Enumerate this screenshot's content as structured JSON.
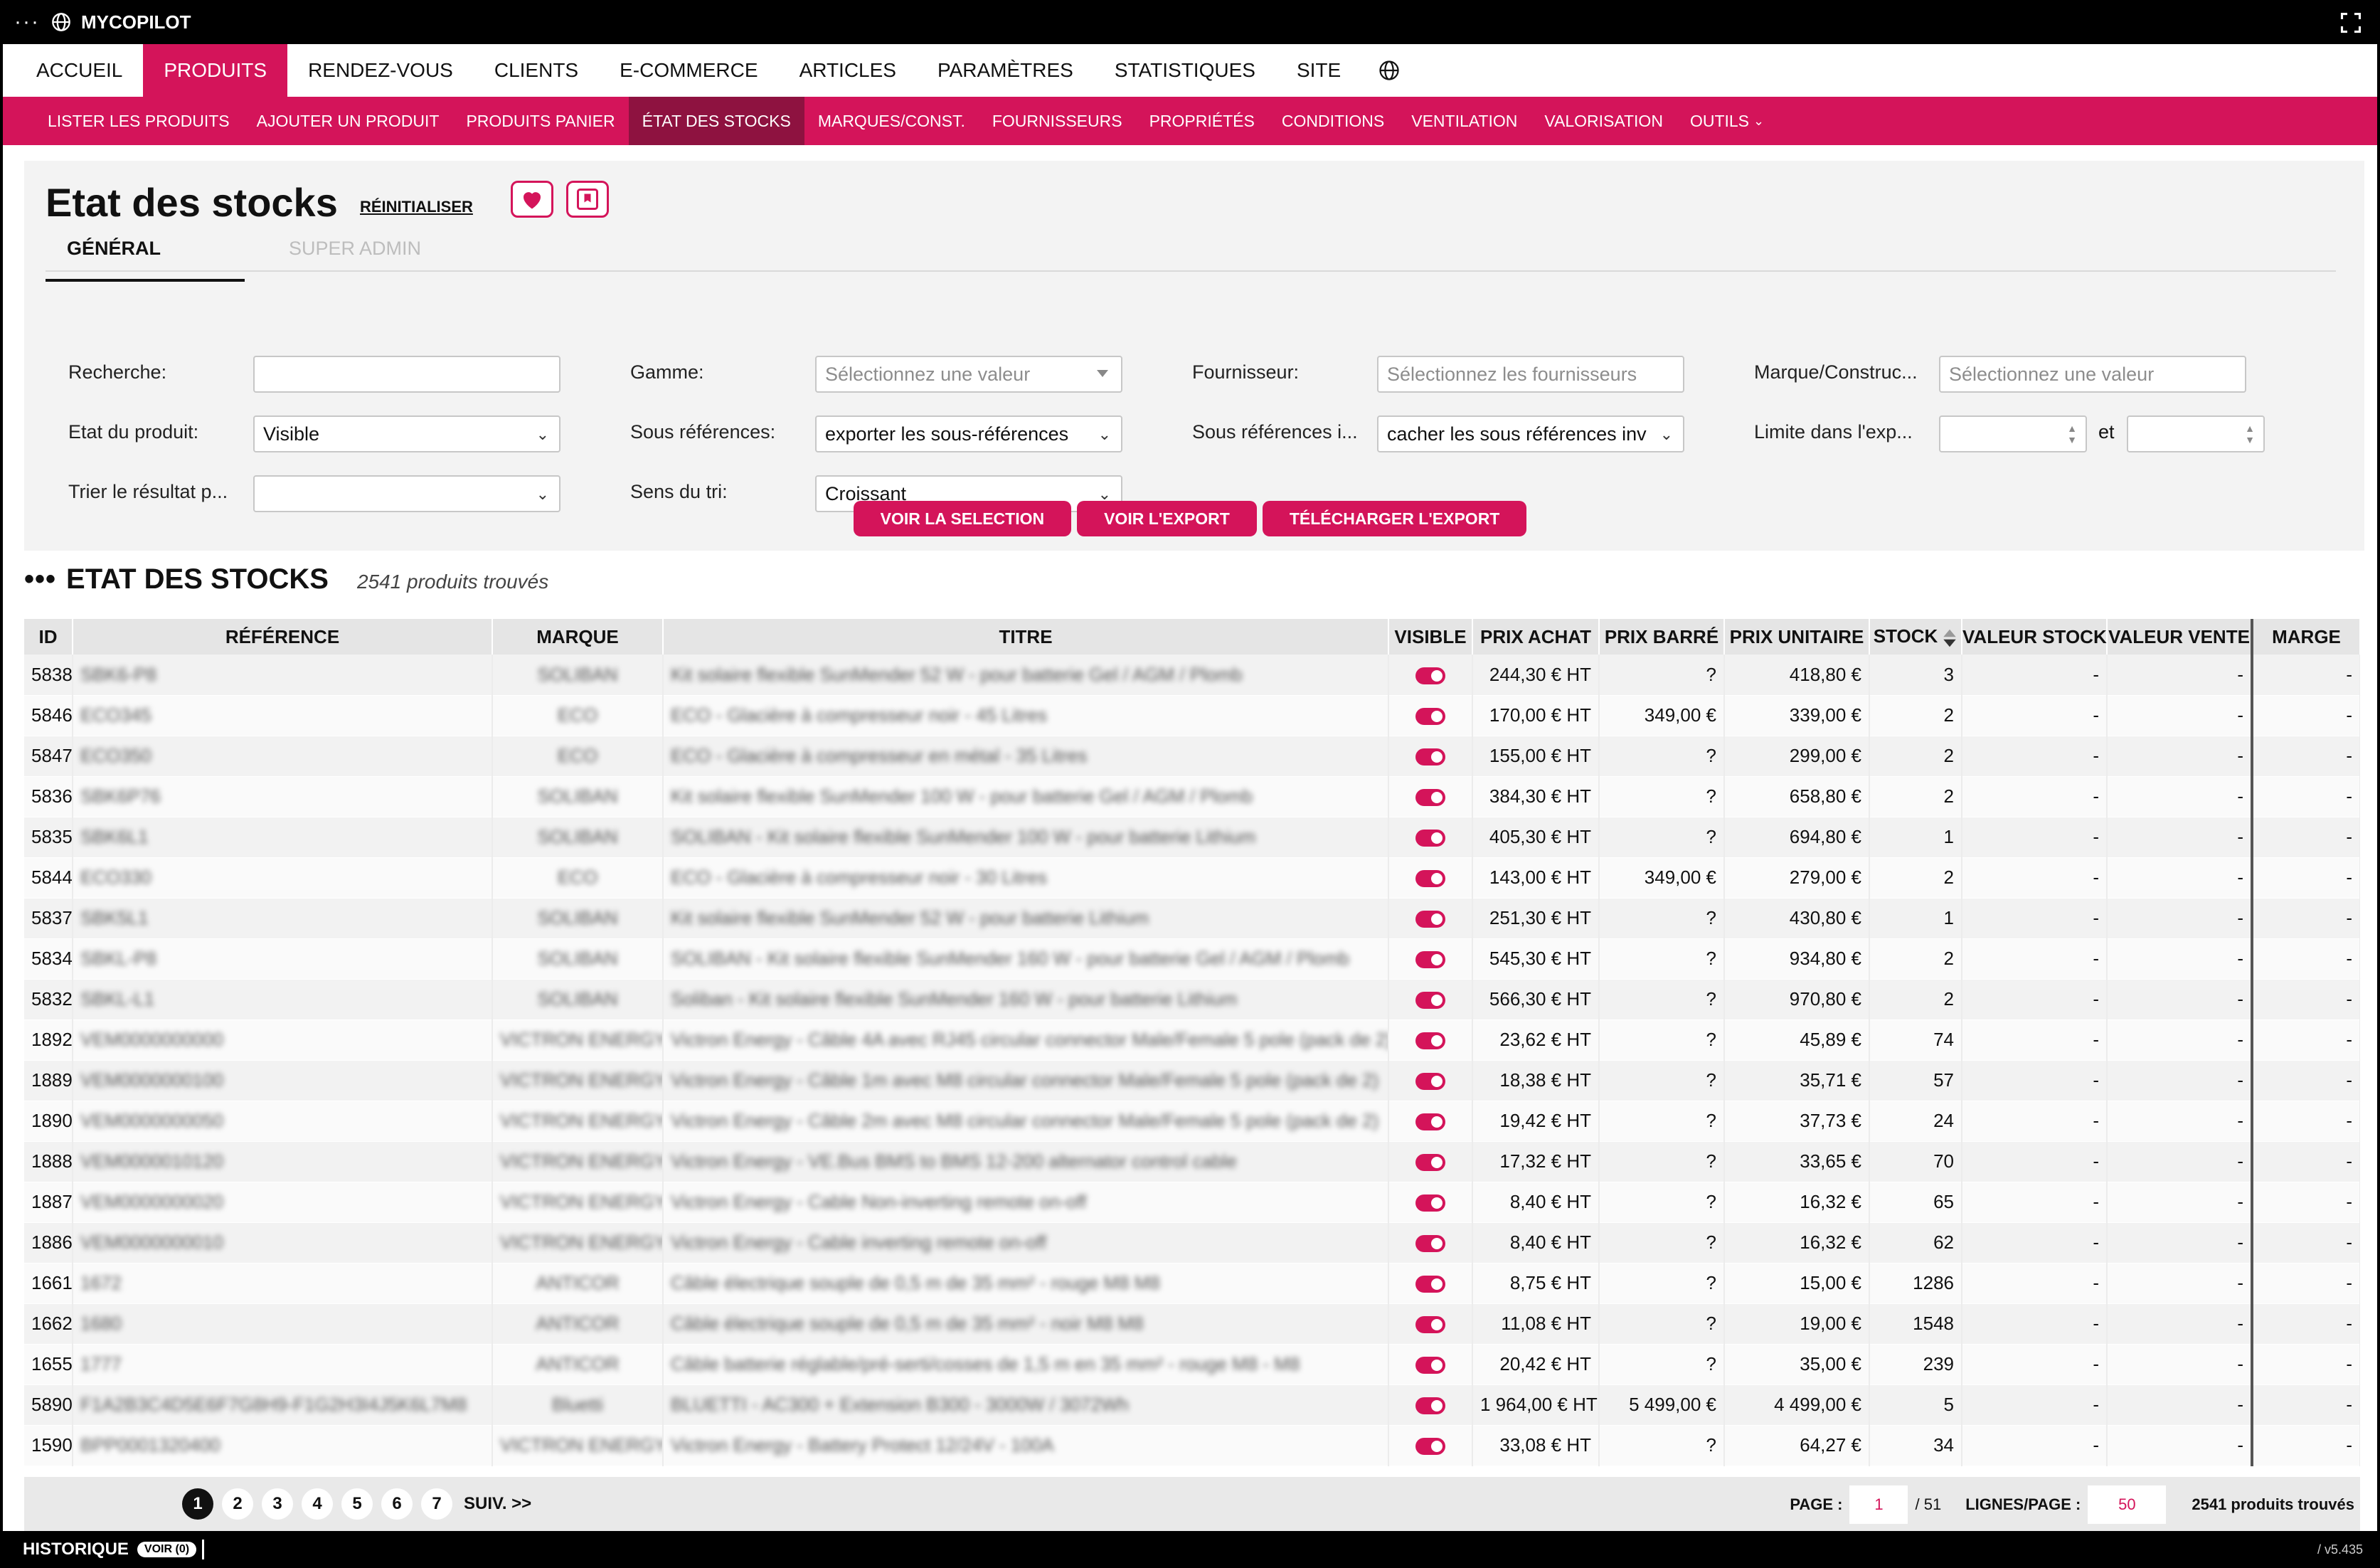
{
  "app": {
    "title": "MYCOPILOT",
    "version": "/ v5.435"
  },
  "mainnav": [
    {
      "label": "ACCUEIL",
      "active": false
    },
    {
      "label": "PRODUITS",
      "active": true
    },
    {
      "label": "RENDEZ-VOUS",
      "active": false
    },
    {
      "label": "CLIENTS",
      "active": false
    },
    {
      "label": "E-COMMERCE",
      "active": false
    },
    {
      "label": "ARTICLES",
      "active": false
    },
    {
      "label": "PARAMÈTRES",
      "active": false
    },
    {
      "label": "STATISTIQUES",
      "active": false
    },
    {
      "label": "SITE",
      "active": false
    }
  ],
  "subnav": [
    {
      "label": "LISTER LES PRODUITS",
      "active": false
    },
    {
      "label": "AJOUTER UN PRODUIT",
      "active": false
    },
    {
      "label": "PRODUITS PANIER",
      "active": false
    },
    {
      "label": "ÉTAT DES STOCKS",
      "active": true
    },
    {
      "label": "MARQUES/CONST.",
      "active": false
    },
    {
      "label": "FOURNISSEURS",
      "active": false
    },
    {
      "label": "PROPRIÉTÉS",
      "active": false
    },
    {
      "label": "CONDITIONS",
      "active": false
    },
    {
      "label": "VENTILATION",
      "active": false
    },
    {
      "label": "VALORISATION",
      "active": false
    },
    {
      "label": "OUTILS",
      "active": false
    }
  ],
  "page": {
    "title": "Etat des stocks",
    "reset_label": "RÉINITIALISER",
    "tabs": [
      "GÉNÉRAL",
      "SUPER ADMIN"
    ]
  },
  "filters": {
    "recherche": {
      "label": "Recherche:",
      "value": ""
    },
    "gamme": {
      "label": "Gamme:",
      "placeholder": "Sélectionnez une valeur"
    },
    "fournisseur": {
      "label": "Fournisseur:",
      "placeholder": "Sélectionnez les fournisseurs"
    },
    "marque": {
      "label": "Marque/Construc...",
      "placeholder": "Sélectionnez une valeur"
    },
    "etat": {
      "label": "Etat du produit:",
      "value": "Visible"
    },
    "sousref": {
      "label": "Sous références:",
      "value": "exporter les sous-références"
    },
    "sousref_inv": {
      "label": "Sous références i...",
      "value": "cacher les sous références inv"
    },
    "limite": {
      "label": "Limite dans l'exp...",
      "and": "et"
    },
    "trier": {
      "label": "Trier le résultat p...",
      "value": ""
    },
    "sens": {
      "label": "Sens du tri:",
      "value": "Croissant"
    }
  },
  "actions": [
    "VOIR LA SELECTION",
    "VOIR L'EXPORT",
    "TÉLÉCHARGER L'EXPORT"
  ],
  "results": {
    "title": "ETAT DES STOCKS",
    "count": "2541 produits trouvés"
  },
  "table": {
    "columns": [
      "ID",
      "RÉFÉRENCE",
      "MARQUE",
      "TITRE",
      "VISIBLE",
      "PRIX ACHAT",
      "PRIX BARRÉ",
      "PRIX UNITAIRE",
      "STOCK",
      "VALEUR STOCK",
      "VALEUR VENTE",
      "MARGE"
    ],
    "rows": [
      {
        "id": "5838",
        "ref": "SBK6-P8",
        "marque": "SOLIBAN",
        "titre": "Kit solaire flexible SunMender 52 W - pour batterie Gel / AGM / Plomb",
        "achat": "244,30 € HT",
        "barre": "?",
        "unit": "418,80 €",
        "stock": "3"
      },
      {
        "id": "5846",
        "ref": "ECO345",
        "marque": "ECO",
        "titre": "ECO - Glacière à compresseur noir - 45 Litres",
        "achat": "170,00 € HT",
        "barre": "349,00 €",
        "unit": "339,00 €",
        "stock": "2"
      },
      {
        "id": "5847",
        "ref": "ECO350",
        "marque": "ECO",
        "titre": "ECO - Glacière à compresseur en métal - 35 Litres",
        "achat": "155,00 € HT",
        "barre": "?",
        "unit": "299,00 €",
        "stock": "2"
      },
      {
        "id": "5836",
        "ref": "SBK6P76",
        "marque": "SOLIBAN",
        "titre": "Kit solaire flexible SunMender 100 W - pour batterie Gel / AGM / Plomb",
        "achat": "384,30 € HT",
        "barre": "?",
        "unit": "658,80 €",
        "stock": "2"
      },
      {
        "id": "5835",
        "ref": "SBK6L1",
        "marque": "SOLIBAN",
        "titre": "SOLIBAN - Kit solaire flexible SunMender 100 W - pour batterie Lithium",
        "achat": "405,30 € HT",
        "barre": "?",
        "unit": "694,80 €",
        "stock": "1"
      },
      {
        "id": "5844",
        "ref": "ECO330",
        "marque": "ECO",
        "titre": "ECO - Glacière à compresseur noir - 30 Litres",
        "achat": "143,00 € HT",
        "barre": "349,00 €",
        "unit": "279,00 €",
        "stock": "2"
      },
      {
        "id": "5837",
        "ref": "SBK5L1",
        "marque": "SOLIBAN",
        "titre": "Kit solaire flexible SunMender 52 W - pour batterie Lithium",
        "achat": "251,30 € HT",
        "barre": "?",
        "unit": "430,80 €",
        "stock": "1"
      },
      {
        "id": "5834",
        "ref": "SBKL-P8",
        "marque": "SOLIBAN",
        "titre": "SOLIBAN - Kit solaire flexible SunMender 160 W - pour batterie Gel / AGM / Plomb",
        "achat": "545,30 € HT",
        "barre": "?",
        "unit": "934,80 €",
        "stock": "2"
      },
      {
        "id": "5832",
        "ref": "SBKL-L1",
        "marque": "SOLIBAN",
        "titre": "Soliban - Kit solaire flexible SunMender 160 W - pour batterie Lithium",
        "achat": "566,30 € HT",
        "barre": "?",
        "unit": "970,80 €",
        "stock": "2"
      },
      {
        "id": "1892",
        "ref": "VEM0000000000",
        "marque": "VICTRON ENERGY",
        "titre": "Victron Energy - Câble 4A avec RJ45 circular connector Male/Female 5 pole (pack de 2)",
        "achat": "23,62 € HT",
        "barre": "?",
        "unit": "45,89 €",
        "stock": "74"
      },
      {
        "id": "1889",
        "ref": "VEM0000000100",
        "marque": "VICTRON ENERGY",
        "titre": "Victron Energy - Câble 1m avec M8 circular connector Male/Female 5 pole (pack de 2)",
        "achat": "18,38 € HT",
        "barre": "?",
        "unit": "35,71 €",
        "stock": "57"
      },
      {
        "id": "1890",
        "ref": "VEM0000000050",
        "marque": "VICTRON ENERGY",
        "titre": "Victron Energy - Câble 2m avec M8 circular connector Male/Female 5 pole (pack de 2)",
        "achat": "19,42 € HT",
        "barre": "?",
        "unit": "37,73 €",
        "stock": "24"
      },
      {
        "id": "1888",
        "ref": "VEM0000010120",
        "marque": "VICTRON ENERGY",
        "titre": "Victron Energy - VE.Bus BMS to BMS 12-200 alternator control cable",
        "achat": "17,32 € HT",
        "barre": "?",
        "unit": "33,65 €",
        "stock": "70"
      },
      {
        "id": "1887",
        "ref": "VEM0000000020",
        "marque": "VICTRON ENERGY",
        "titre": "Victron Energy - Cable Non-inverting remote on-off",
        "achat": "8,40 € HT",
        "barre": "?",
        "unit": "16,32 €",
        "stock": "65"
      },
      {
        "id": "1886",
        "ref": "VEM0000000010",
        "marque": "VICTRON ENERGY",
        "titre": "Victron Energy - Cable inverting remote on-off",
        "achat": "8,40 € HT",
        "barre": "?",
        "unit": "16,32 €",
        "stock": "62"
      },
      {
        "id": "1661",
        "ref": "1672",
        "marque": "ANTICOR",
        "titre": "Câble électrique souple de 0,5 m de 35 mm² - rouge M8 M8",
        "achat": "8,75 € HT",
        "barre": "?",
        "unit": "15,00 €",
        "stock": "1286"
      },
      {
        "id": "1662",
        "ref": "1680",
        "marque": "ANTICOR",
        "titre": "Câble électrique souple de 0,5 m de 35 mm² - noir M8 M8",
        "achat": "11,08 € HT",
        "barre": "?",
        "unit": "19,00 €",
        "stock": "1548"
      },
      {
        "id": "1655",
        "ref": "1777",
        "marque": "ANTICOR",
        "titre": "Câble batterie réglable/pré-serti/cosses de 1,5 m en 35 mm² - rouge M8 - M8",
        "achat": "20,42 € HT",
        "barre": "?",
        "unit": "35,00 €",
        "stock": "239"
      },
      {
        "id": "5890",
        "ref": "F1A2B3C4D5E6F7G8H9-F1G2H3I4J5K6L7M8",
        "marque": "Bluetti",
        "titre": "BLUETTI - AC300 + Extension B300 - 3000W / 3072Wh",
        "achat": "1 964,00 € HT",
        "barre": "5 499,00 €",
        "unit": "4 499,00 €",
        "stock": "5"
      },
      {
        "id": "1590",
        "ref": "BPP0001320400",
        "marque": "VICTRON ENERGY",
        "titre": "Victron Energy - Battery Protect 12/24V - 100A",
        "achat": "33,08 € HT",
        "barre": "?",
        "unit": "64,27 €",
        "stock": "34"
      }
    ],
    "empty_value": "-"
  },
  "pagination": {
    "pages": [
      "1",
      "2",
      "3",
      "4",
      "5",
      "6",
      "7"
    ],
    "current": "1",
    "next_label": "SUIV. >>",
    "page_label": "PAGE :",
    "page_value": "1",
    "page_total": "/ 51",
    "lines_label": "LIGNES/PAGE :",
    "lines_value": "50",
    "count": "2541 produits trouvés"
  },
  "bottom": {
    "history_label": "HISTORIQUE",
    "voir_label": "VOIR (0)"
  },
  "colors": {
    "accent": "#d4145a",
    "accent_dark": "#8e1240"
  }
}
